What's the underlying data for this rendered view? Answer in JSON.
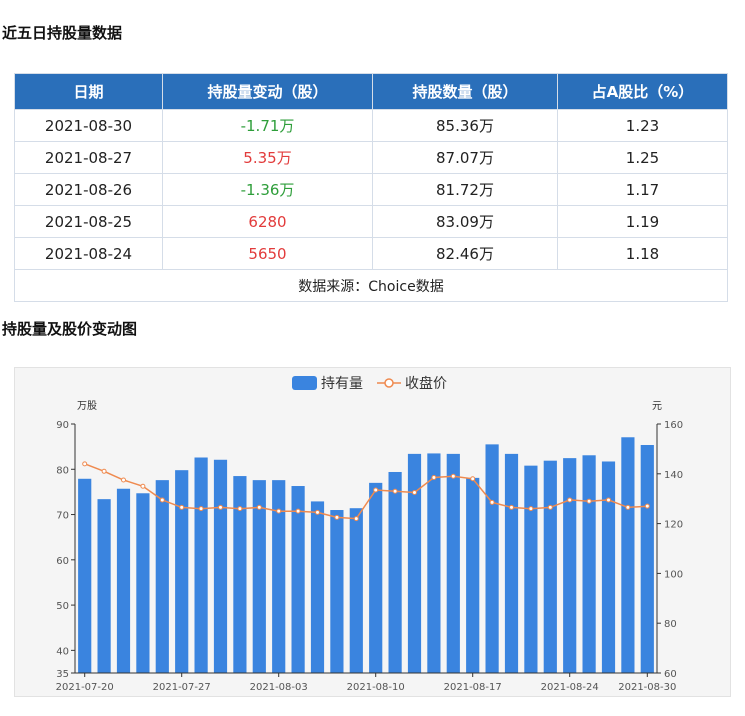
{
  "section1_title": "近五日持股量数据",
  "section2_title": "持股量及股价变动图",
  "table": {
    "headers": [
      "日期",
      "持股量变动（股）",
      "持股数量（股）",
      "占A股比（%）"
    ],
    "rows": [
      {
        "date": "2021-08-30",
        "change": "-1.71万",
        "dir": "neg",
        "shares": "85.36万",
        "ratio": "1.23"
      },
      {
        "date": "2021-08-27",
        "change": "5.35万",
        "dir": "pos",
        "shares": "87.07万",
        "ratio": "1.25"
      },
      {
        "date": "2021-08-26",
        "change": "-1.36万",
        "dir": "neg",
        "shares": "81.72万",
        "ratio": "1.17"
      },
      {
        "date": "2021-08-25",
        "change": "6280",
        "dir": "pos",
        "shares": "83.09万",
        "ratio": "1.19"
      },
      {
        "date": "2021-08-24",
        "change": "5650",
        "dir": "pos",
        "shares": "82.46万",
        "ratio": "1.18"
      }
    ],
    "source": "数据来源：Choice数据"
  },
  "colors": {
    "header_bg": "#2a6fba",
    "bar": "#3a84df",
    "line": "#ef8a4f",
    "pos": "#e23b3b",
    "neg": "#2e9e3a"
  },
  "chart_data": {
    "type": "bar+line",
    "legend": [
      "持有量",
      "收盘价"
    ],
    "left_unit": "万股",
    "right_unit": "元",
    "y_left_range": [
      35,
      90
    ],
    "y_left_ticks": [
      35,
      40,
      50,
      60,
      70,
      80,
      90
    ],
    "y_right_range": [
      60,
      160
    ],
    "y_right_ticks": [
      60,
      80,
      100,
      120,
      140,
      160
    ],
    "x_tick_labels": [
      "2021-07-20",
      "2021-07-27",
      "2021-08-03",
      "2021-08-10",
      "2021-08-17",
      "2021-08-24",
      "2021-08-30"
    ],
    "x_tick_indices": [
      0,
      5,
      10,
      15,
      20,
      25,
      29
    ],
    "dates": [
      "2021-07-20",
      "2021-07-21",
      "2021-07-22",
      "2021-07-23",
      "2021-07-26",
      "2021-07-27",
      "2021-07-28",
      "2021-07-29",
      "2021-07-30",
      "2021-08-02",
      "2021-08-03",
      "2021-08-04",
      "2021-08-05",
      "2021-08-06",
      "2021-08-09",
      "2021-08-10",
      "2021-08-11",
      "2021-08-12",
      "2021-08-13",
      "2021-08-16",
      "2021-08-17",
      "2021-08-18",
      "2021-08-19",
      "2021-08-20",
      "2021-08-23",
      "2021-08-24",
      "2021-08-25",
      "2021-08-26",
      "2021-08-27",
      "2021-08-30"
    ],
    "series": [
      {
        "name": "持有量",
        "type": "bar",
        "axis": "left",
        "values": [
          77.9,
          73.4,
          75.7,
          74.7,
          77.6,
          79.8,
          82.6,
          82.1,
          78.5,
          77.6,
          77.6,
          76.3,
          72.9,
          71.0,
          71.4,
          77.0,
          79.4,
          83.4,
          83.5,
          83.4,
          78.1,
          85.5,
          83.4,
          80.8,
          81.9,
          82.46,
          83.09,
          81.72,
          87.07,
          85.36
        ]
      },
      {
        "name": "收盘价",
        "type": "line",
        "axis": "right",
        "values": [
          144.0,
          141.0,
          137.5,
          135.0,
          129.5,
          126.5,
          126.0,
          126.5,
          126.0,
          126.5,
          125.0,
          125.0,
          124.5,
          122.5,
          122.0,
          133.5,
          133.0,
          132.5,
          138.5,
          139.0,
          138.0,
          128.5,
          126.5,
          126.0,
          126.5,
          129.5,
          129.0,
          129.5,
          126.5,
          127.0
        ]
      }
    ]
  }
}
